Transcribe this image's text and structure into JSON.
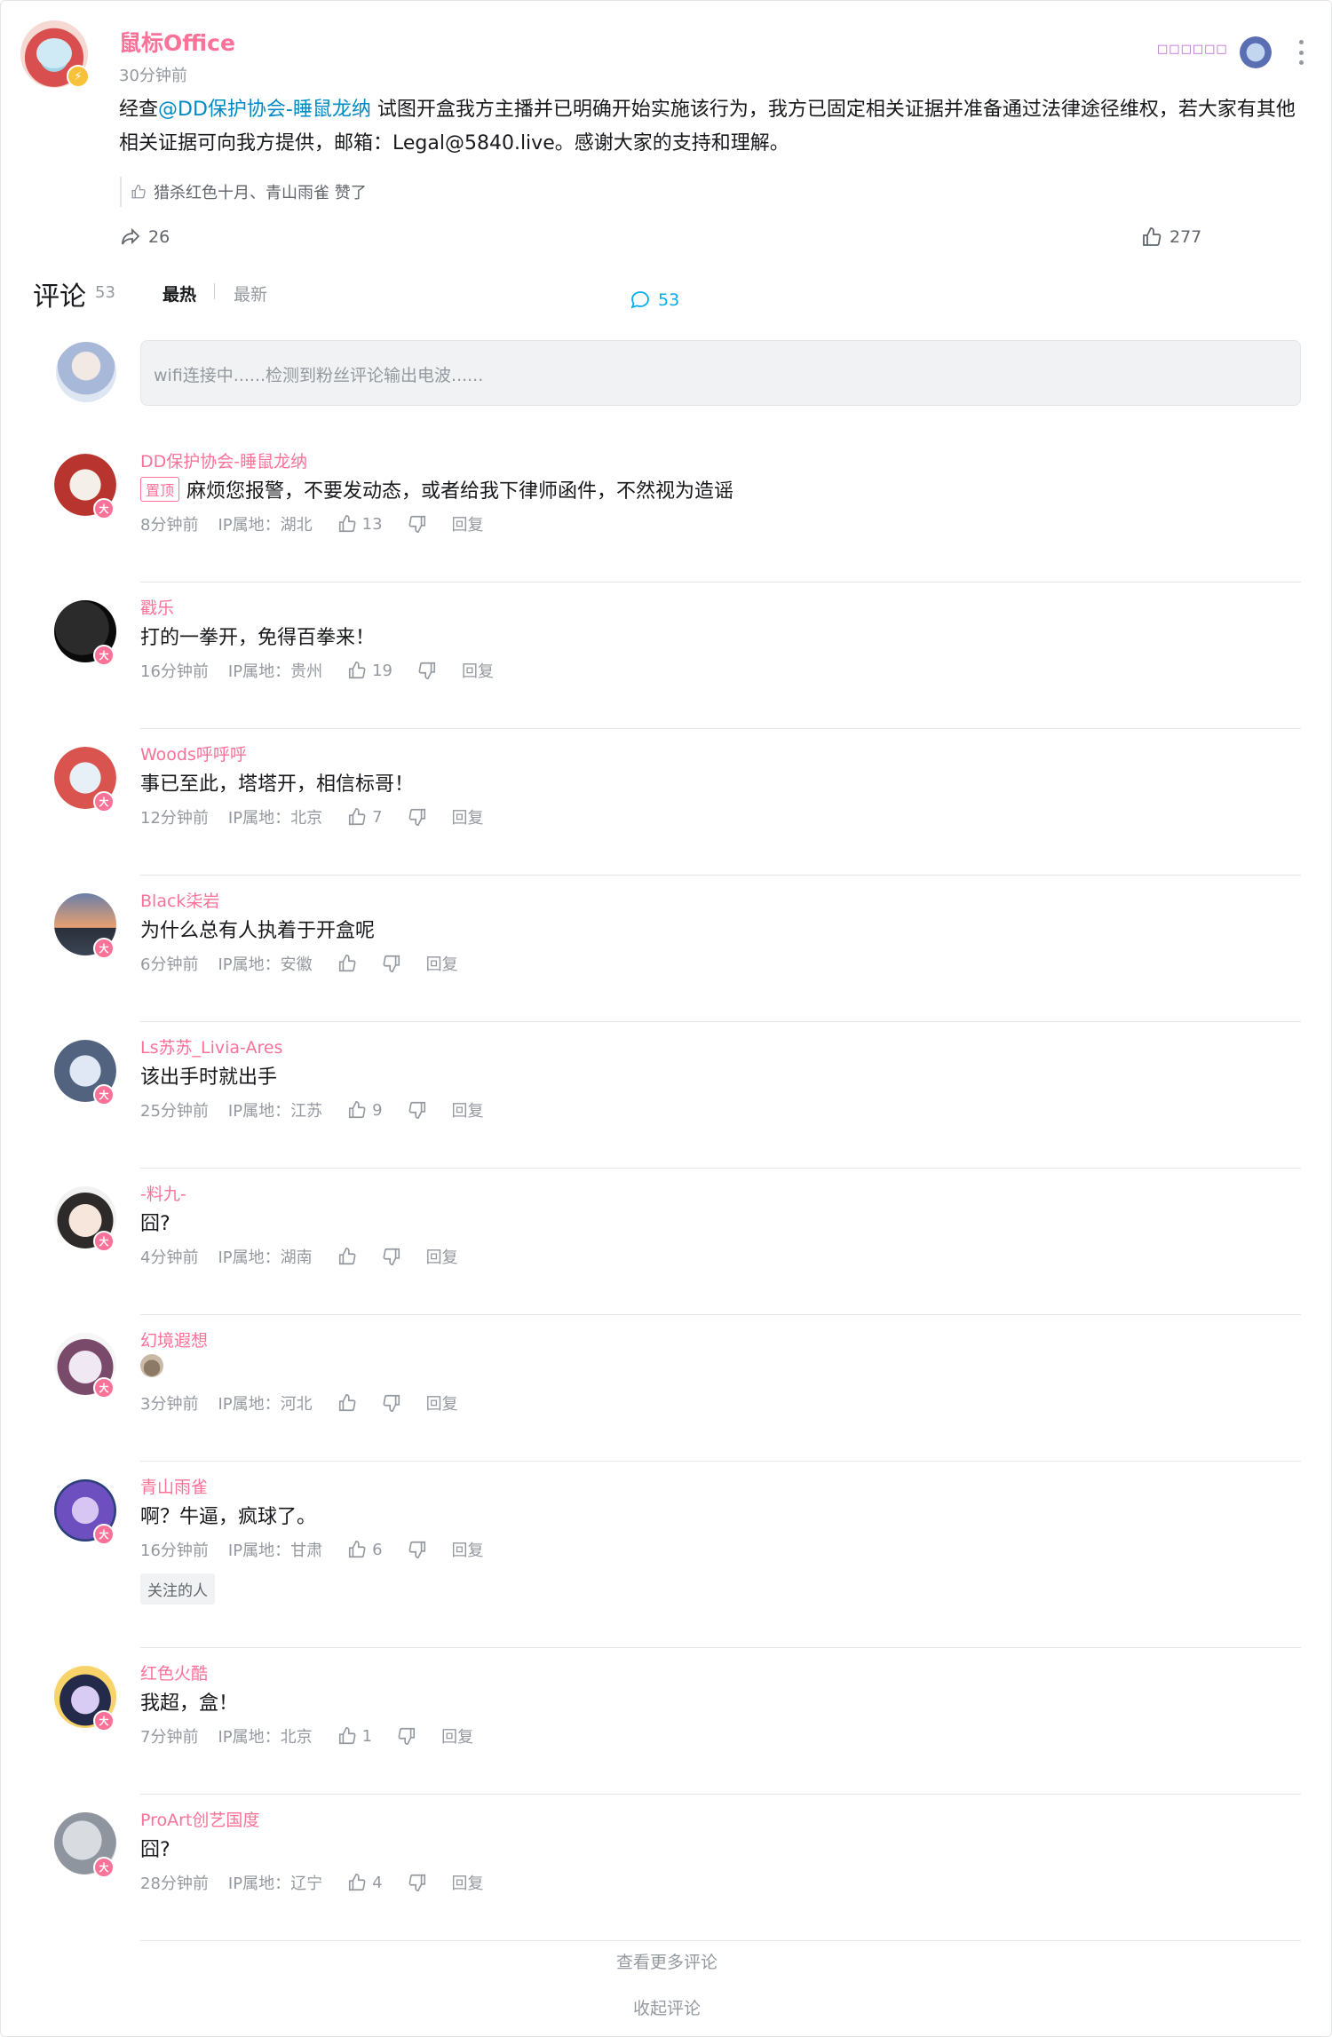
{
  "post": {
    "author": "鼠标Office",
    "time": "30分钟前",
    "badge_text": "□□□□□□",
    "text_before": "经查",
    "mention": "@DD保护协会-睡鼠龙纳",
    "text_after": " 试图开盒我方主播并已明确开始实施该行为，我方已固定相关证据并准备通过法律途径维权，若大家有其他相关证据可向我方提供，邮箱：Legal@5840.live。感谢大家的支持和理解。",
    "liked_by": "猎杀红色十月、青山雨雀 赞了",
    "share_count": "26",
    "comment_count": "53",
    "like_count": "277",
    "colors": {
      "accent": "#fb7299",
      "link": "#008ac5",
      "comment_active": "#00aeec"
    }
  },
  "comments_header": {
    "title": "评论",
    "count": "53",
    "sort_hot": "最热",
    "sort_new": "最新"
  },
  "reply_box": {
    "placeholder": "wifi连接中......检测到粉丝评论输出电波......"
  },
  "comments": [
    {
      "user": "DD保护协会-睡鼠龙纳",
      "pinned": "置顶",
      "text": "麻烦您报警，不要发动态，或者给我下律师函件，不然视为造谣",
      "time": "8分钟前",
      "ip": "IP属地：湖北",
      "likes": "13",
      "reply": "回复"
    },
    {
      "user": "戳乐",
      "text": "打的一拳开，免得百拳来！",
      "time": "16分钟前",
      "ip": "IP属地：贵州",
      "likes": "19",
      "reply": "回复"
    },
    {
      "user": "Woods呼呼呼",
      "text": "事已至此，塔塔开，相信标哥！",
      "time": "12分钟前",
      "ip": "IP属地：北京",
      "likes": "7",
      "reply": "回复"
    },
    {
      "user": "Black柒岩",
      "text": "为什么总有人执着于开盒呢",
      "time": "6分钟前",
      "ip": "IP属地：安徽",
      "likes": "",
      "reply": "回复"
    },
    {
      "user": "Ls苏苏_Livia-Ares",
      "text": "该出手时就出手",
      "time": "25分钟前",
      "ip": "IP属地：江苏",
      "likes": "9",
      "reply": "回复"
    },
    {
      "user": "-料九-",
      "text": "囧?",
      "time": "4分钟前",
      "ip": "IP属地：湖南",
      "likes": "",
      "reply": "回复"
    },
    {
      "user": "幻境遐想",
      "text": "",
      "emoji": "poop-emoji",
      "time": "3分钟前",
      "ip": "IP属地：河北",
      "likes": "",
      "reply": "回复"
    },
    {
      "user": "青山雨雀",
      "text": "啊？牛逼，疯球了。",
      "time": "16分钟前",
      "ip": "IP属地：甘肃",
      "likes": "6",
      "reply": "回复",
      "tag": "关注的人"
    },
    {
      "user": "红色火酷",
      "text": "我超，盒！",
      "time": "7分钟前",
      "ip": "IP属地：北京",
      "likes": "1",
      "reply": "回复"
    },
    {
      "user": "ProArt创艺国度",
      "text": "囧?",
      "time": "28分钟前",
      "ip": "IP属地：辽宁",
      "likes": "4",
      "reply": "回复"
    }
  ],
  "footer": {
    "see_more": "查看更多评论",
    "collapse": "收起评论"
  }
}
